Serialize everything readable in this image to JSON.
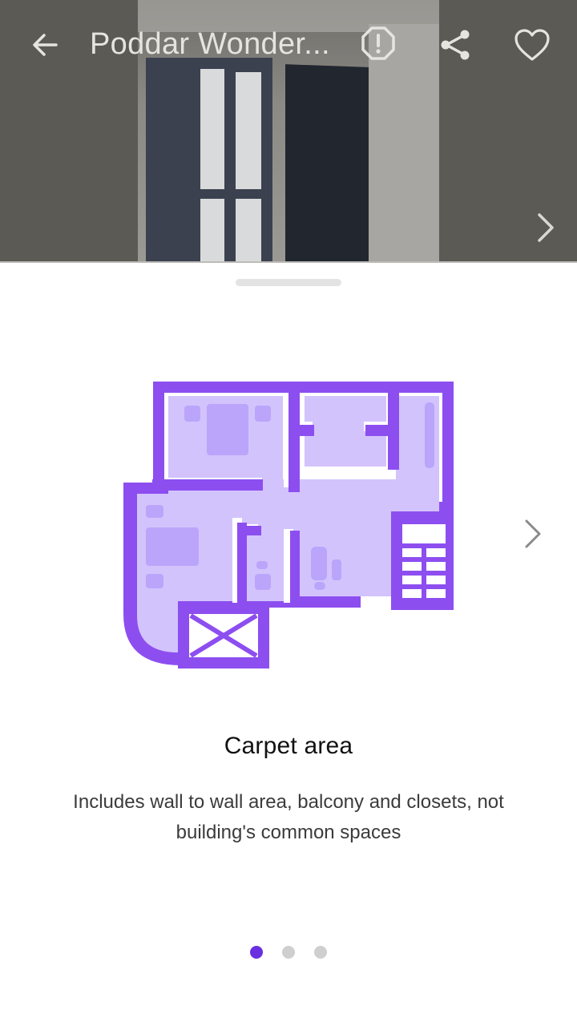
{
  "header": {
    "title": "Poddar Wonder...",
    "icons": {
      "back": "arrow-left-icon",
      "report": "alert-octagon-icon",
      "share": "share-icon",
      "favorite": "heart-outline-icon",
      "photo_next": "chevron-right-icon"
    }
  },
  "sheet": {
    "info_title": "Carpet area",
    "info_description": "Includes wall to wall area, balcony and closets, not building's common spaces",
    "illustration": "floor-plan-illustration",
    "next_icon": "chevron-right-icon",
    "pager": {
      "total": 3,
      "active": 1
    }
  },
  "colors": {
    "accent": "#6a2fe0",
    "plan_wall": "#8d4ef0",
    "plan_fill": "#d2c3fd",
    "plan_furniture": "#bba5fa",
    "dot_inactive": "#cfcfcf"
  }
}
